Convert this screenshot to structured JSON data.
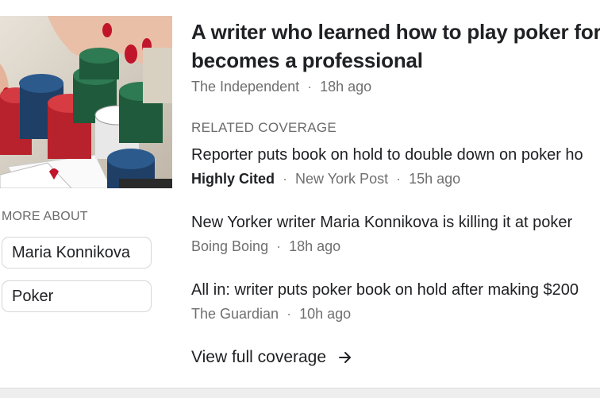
{
  "story": {
    "headline_line1": "A writer who learned how to play poker for",
    "headline_line2": "becomes a professional",
    "source": "The Independent",
    "time": "18h ago",
    "image_icon": "poker-chips-photo"
  },
  "more_about": {
    "label": "MORE ABOUT",
    "topics": [
      "Maria Konnikova",
      "Poker"
    ]
  },
  "related": {
    "label": "RELATED COVERAGE",
    "items": [
      {
        "title": "Reporter puts book on hold to double down on poker ho",
        "badge": "Highly Cited",
        "source": "New York Post",
        "time": "15h ago"
      },
      {
        "title": "New Yorker writer Maria Konnikova is killing it at poker",
        "source": "Boing Boing",
        "time": "18h ago"
      },
      {
        "title": "All in: writer puts poker book on hold after making $200",
        "source": "The Guardian",
        "time": "10h ago"
      }
    ]
  },
  "full_coverage": {
    "label": "View full coverage",
    "icon": "arrow-right-icon"
  },
  "colors": {
    "text_primary": "#202124",
    "text_secondary": "#6f6f6f",
    "chip_border": "#d6d6d6",
    "bottom_band": "#eeeeee"
  }
}
